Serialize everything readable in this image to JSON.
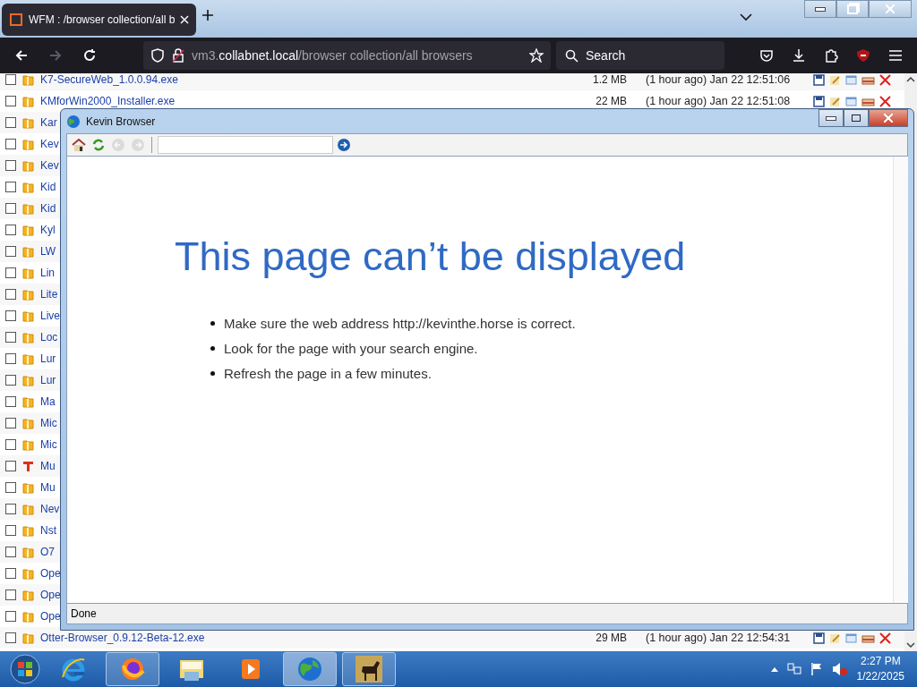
{
  "browser": {
    "tabs": [
      {
        "title": "WFM : /browser collection/all b",
        "selected": true
      }
    ],
    "nav_buttons": [
      {
        "kind": "back",
        "disabled": false
      },
      {
        "kind": "forward",
        "disabled": true
      },
      {
        "kind": "reload",
        "disabled": false
      }
    ],
    "address": {
      "prefix": "vm3.",
      "domain": "collabnet.local",
      "path": "/browser collection/all browsers"
    },
    "search": {
      "placeholder": "Search"
    }
  },
  "file_list": {
    "rows": [
      {
        "kind": "folder",
        "name": "K7-SecureWeb_1.0.0.94.exe",
        "size": "1.2 MB",
        "date": "(1 hour ago) Jan 22 12:51:06",
        "checked": false
      },
      {
        "kind": "folder",
        "name": "KMforWin2000_Installer.exe",
        "size": "22 MB",
        "date": "(1 hour ago) Jan 22 12:51:08",
        "checked": false
      },
      {
        "kind": "folder",
        "name": "Kar",
        "checked": false
      },
      {
        "kind": "folder",
        "name": "Kev",
        "checked": false
      },
      {
        "kind": "folder",
        "name": "Kev",
        "checked": false
      },
      {
        "kind": "folder",
        "name": "Kid",
        "checked": false
      },
      {
        "kind": "folder",
        "name": "Kid",
        "checked": false
      },
      {
        "kind": "folder",
        "name": "Kyl",
        "checked": false
      },
      {
        "kind": "folder",
        "name": "LW",
        "checked": false
      },
      {
        "kind": "folder",
        "name": "Lin",
        "checked": false
      },
      {
        "kind": "folder",
        "name": "Lite",
        "checked": false
      },
      {
        "kind": "folder",
        "name": "Live",
        "checked": false
      },
      {
        "kind": "folder",
        "name": "Loc",
        "checked": false
      },
      {
        "kind": "folder",
        "name": "Lur",
        "checked": false
      },
      {
        "kind": "folder",
        "name": "Lur",
        "checked": false
      },
      {
        "kind": "folder",
        "name": "Ma",
        "checked": false
      },
      {
        "kind": "folder",
        "name": "Mic",
        "checked": false
      },
      {
        "kind": "folder",
        "name": "Mic",
        "checked": false
      },
      {
        "kind": "tool",
        "name": "Mu",
        "checked": false
      },
      {
        "kind": "folder",
        "name": "Mu",
        "checked": false
      },
      {
        "kind": "folder",
        "name": "Nev",
        "checked": false
      },
      {
        "kind": "folder",
        "name": "Nst",
        "checked": false
      },
      {
        "kind": "folder",
        "name": "O7",
        "checked": false
      },
      {
        "kind": "folder",
        "name": "Ope",
        "checked": false
      },
      {
        "kind": "folder",
        "name": "Ope",
        "checked": false
      },
      {
        "kind": "folder",
        "name": "Ope",
        "checked": false
      },
      {
        "kind": "folder",
        "name": "Otter-Browser_0.9.12-Beta-12.exe",
        "size": "29 MB",
        "date": "(1 hour ago) Jan 22 12:54:31",
        "checked": false
      }
    ]
  },
  "popup_window": {
    "title": "Kevin Browser",
    "toolbar": [
      {
        "kind": "home",
        "disabled": false
      },
      {
        "kind": "refresh",
        "disabled": false
      },
      {
        "kind": "back",
        "disabled": true
      },
      {
        "kind": "forward",
        "disabled": true
      }
    ],
    "heading": "This page can’t be displayed",
    "bullets": [
      "Make sure the web address http://kevinthe.horse is correct.",
      "Look for the page with your search engine.",
      "Refresh the page in a few minutes."
    ],
    "status": "Done"
  },
  "taskbar": {
    "apps": [
      {
        "kind": "ie",
        "running": false,
        "selected": false
      },
      {
        "kind": "firefox",
        "running": true,
        "selected": false
      },
      {
        "kind": "explorer",
        "running": false,
        "selected": false
      },
      {
        "kind": "media",
        "running": false,
        "selected": false
      },
      {
        "kind": "globe",
        "running": true,
        "selected": true
      },
      {
        "kind": "horse",
        "running": true,
        "selected": false
      }
    ],
    "clock": {
      "time": "2:27 PM",
      "date": "1/22/2025"
    }
  }
}
